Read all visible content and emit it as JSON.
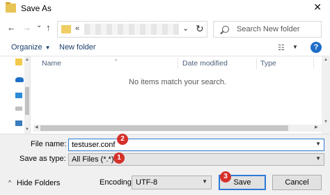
{
  "window": {
    "title": "Save As",
    "close_glyph": "✕"
  },
  "nav": {
    "back_icon": "←",
    "forward_icon": "→",
    "recent_icon": "⌄",
    "up_icon": "↑",
    "address_chevron": "«",
    "address_dropdown": "⌄",
    "refresh_icon": "↻",
    "search_placeholder": "Search New folder"
  },
  "toolbar": {
    "organize_label": "Organize",
    "organize_arrow": "▼",
    "new_folder_label": "New folder",
    "view_icon": "☷",
    "view_arrow": "▼",
    "help_icon": "?"
  },
  "file_list": {
    "columns": [
      "Name",
      "Date modified",
      "Type"
    ],
    "sort_indicator": "^",
    "empty_message": "No items match your search."
  },
  "form": {
    "file_name_label": "File name:",
    "file_name_value": "testuser.conf",
    "save_as_type_label": "Save as type:",
    "save_as_type_value": "All Files  (*.*)",
    "encoding_label": "Encoding:",
    "encoding_value": "UTF-8",
    "dropdown_arrow": "▼"
  },
  "footer": {
    "hide_folders_label": "Hide Folders",
    "hide_folders_icon": "^",
    "save_label": "Save",
    "cancel_label": "Cancel"
  },
  "annotations": {
    "badge_1": "1",
    "badge_2": "2",
    "badge_3": "3"
  },
  "colors": {
    "accent": "#2d7ad6",
    "badge": "#d5312b",
    "link": "#1a3e6a"
  }
}
